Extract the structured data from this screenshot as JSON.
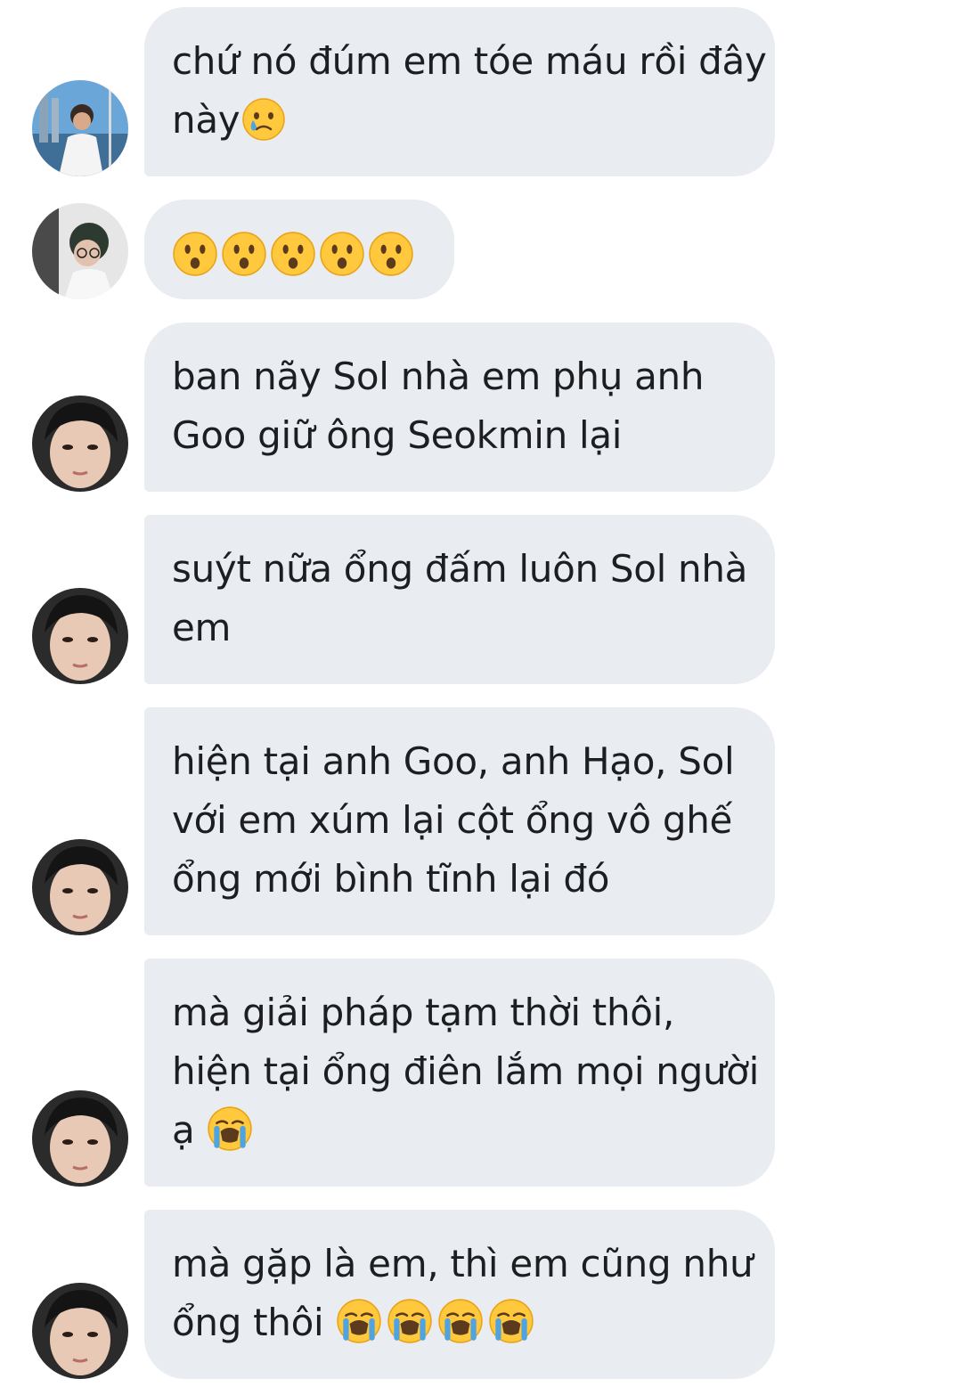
{
  "conversation": {
    "messages": [
      {
        "sender": "user-a",
        "lines": [
          "chứ nó đúm em tóe máu rồi đây",
          "này"
        ],
        "trailing_emoji": [
          "crying-face"
        ]
      },
      {
        "sender": "user-b",
        "lines": [],
        "emoji_only": [
          "hushed-face",
          "hushed-face",
          "hushed-face",
          "hushed-face",
          "hushed-face"
        ]
      },
      {
        "sender": "user-c",
        "lines": [
          "ban nãy Sol nhà em phụ anh",
          "Goo giữ ông Seokmin lại"
        ]
      },
      {
        "sender": "user-c",
        "lines": [
          "suýt nữa ổng đấm luôn Sol nhà",
          "em"
        ]
      },
      {
        "sender": "user-c",
        "lines": [
          "hiện tại anh Goo, anh Hạo, Sol",
          "với em xúm lại cột ổng vô ghế",
          "ổng mới bình tĩnh lại đó"
        ]
      },
      {
        "sender": "user-c",
        "lines": [
          "mà giải pháp tạm thời thôi,",
          "hiện tại ổng điên lắm mọi người",
          "ạ"
        ],
        "trailing_emoji": [
          "loudly-crying-face"
        ]
      },
      {
        "sender": "user-c",
        "lines": [
          "mà gặp là em, thì em cũng như",
          "ổng thôi"
        ],
        "trailing_emoji": [
          "loudly-crying-face",
          "loudly-crying-face",
          "loudly-crying-face",
          "loudly-crying-face"
        ]
      }
    ]
  },
  "colors": {
    "bubble_bg": "#e9ecf0",
    "text": "#1c1e21",
    "emoji_yellow": "#ffc83d",
    "emoji_tear": "#4fa3e0"
  }
}
